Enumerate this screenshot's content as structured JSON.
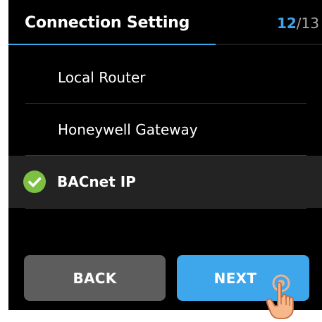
{
  "header": {
    "title": "Connection Setting",
    "step_current": "12",
    "step_separator": "/",
    "step_total": "13",
    "progress": 0.66
  },
  "options": [
    {
      "label": "Local Router",
      "selected": false
    },
    {
      "label": "Honeywell Gateway",
      "selected": false
    },
    {
      "label": "BACnet IP",
      "selected": true
    }
  ],
  "buttons": {
    "back_label": "BACK",
    "next_label": "NEXT"
  },
  "colors": {
    "accent": "#3ea6ea",
    "check": "#7cc142",
    "back_button": "#5d5d5d",
    "background": "#000000"
  },
  "icons": {
    "selected_marker": "check-circle-icon",
    "pointer": "hand-pointer-icon"
  }
}
